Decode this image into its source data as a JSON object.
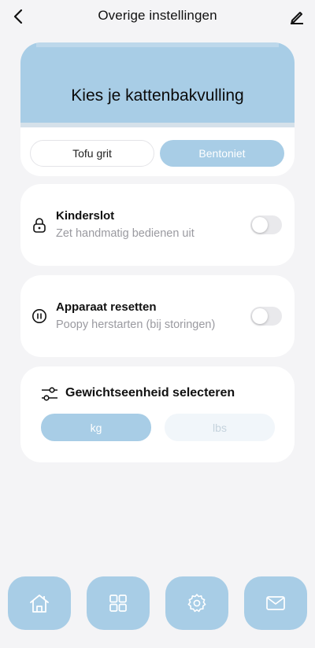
{
  "header": {
    "title": "Overige instellingen",
    "back_icon": "chevron-left-icon",
    "edit_icon": "pencil-icon"
  },
  "litter": {
    "title": "Kies je kattenbakvulling",
    "options": [
      "Tofu grit",
      "Bentoniet"
    ],
    "selected": "Bentoniet"
  },
  "child_lock": {
    "icon": "lock-icon",
    "title": "Kinderslot",
    "subtitle": "Zet handmatig bedienen uit",
    "enabled": false
  },
  "reset": {
    "icon": "pause-circle-icon",
    "title": "Apparaat resetten",
    "subtitle": "Poopy herstarten (bij storingen)",
    "enabled": false
  },
  "weight": {
    "icon": "sliders-icon",
    "title": "Gewichtseenheid selecteren",
    "units": [
      "kg",
      "lbs"
    ],
    "selected": "kg"
  },
  "bottom_nav": {
    "items": [
      "home-icon",
      "grid-icon",
      "settings-icon",
      "mail-icon"
    ]
  },
  "colors": {
    "accent": "#a8cde6",
    "background": "#f4f4f6",
    "card": "#ffffff",
    "muted_text": "#9a9aa0"
  }
}
